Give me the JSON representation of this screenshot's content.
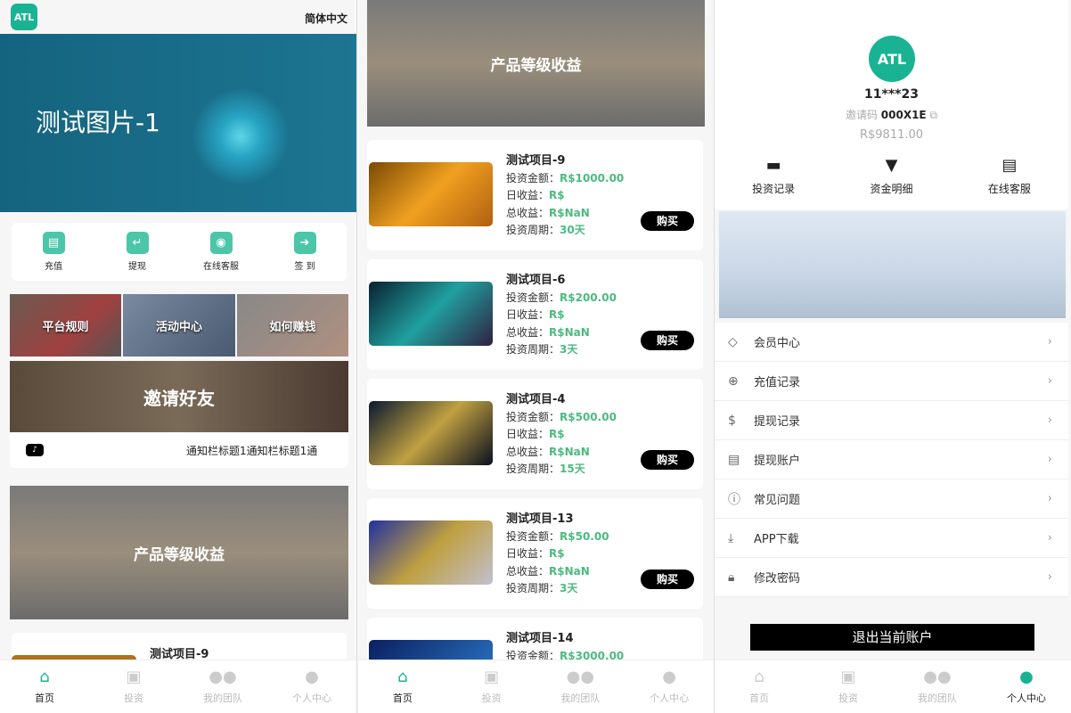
{
  "header": {
    "logo": "ATL",
    "language": "简体中文"
  },
  "home": {
    "banner_title": "测试图片-1",
    "quick": [
      {
        "label": "充值",
        "icon": "recharge-icon"
      },
      {
        "label": "提现",
        "icon": "withdraw-icon"
      },
      {
        "label": "在线客服",
        "icon": "support-icon"
      },
      {
        "label": "签 到",
        "icon": "checkin-icon"
      }
    ],
    "tiles": [
      "平台规则",
      "活动中心",
      "如何赚钱"
    ],
    "invite": "邀请好友",
    "notice": "通知栏标题1通知栏标题1通",
    "product_banner": "产品等级收益",
    "first_product": "测试项目-9"
  },
  "invest": {
    "banner": "产品等级收益",
    "labels": {
      "amount": "投资金额：",
      "daily": "日收益：",
      "total": "总收益：",
      "period": "投资周期：",
      "buy": "购买"
    },
    "products": [
      {
        "name": "测试项目-9",
        "amount": "R$1000.00",
        "daily": "R$",
        "total": "R$NaN",
        "period": "30天"
      },
      {
        "name": "测试项目-6",
        "amount": "R$200.00",
        "daily": "R$",
        "total": "R$NaN",
        "period": "3天"
      },
      {
        "name": "测试项目-4",
        "amount": "R$500.00",
        "daily": "R$",
        "total": "R$NaN",
        "period": "15天"
      },
      {
        "name": "测试项目-13",
        "amount": "R$50.00",
        "daily": "R$",
        "total": "R$NaN",
        "period": "3天"
      },
      {
        "name": "测试项目-14",
        "amount": "R$3000.00"
      }
    ]
  },
  "profile": {
    "avatar": "ATL",
    "username": "11***23",
    "invite_label": "邀请码",
    "invite_code": "000X1E",
    "balance": "R$9811.00",
    "actions": [
      {
        "label": "投资记录",
        "icon": "card-icon"
      },
      {
        "label": "资金明细",
        "icon": "atm-icon"
      },
      {
        "label": "在线客服",
        "icon": "document-icon"
      }
    ],
    "menu": [
      {
        "label": "会员中心",
        "icon": "diamond-icon"
      },
      {
        "label": "充值记录",
        "icon": "recharge-icon"
      },
      {
        "label": "提现记录",
        "icon": "dollar-icon"
      },
      {
        "label": "提现账户",
        "icon": "account-icon"
      },
      {
        "label": "常见问题",
        "icon": "info-icon"
      },
      {
        "label": "APP下载",
        "icon": "download-icon"
      },
      {
        "label": "修改密码",
        "icon": "lock-icon"
      }
    ],
    "logout": "退出当前账户"
  },
  "tabbar": {
    "items": [
      "首页",
      "投资",
      "我的团队",
      "个人中心"
    ]
  },
  "colors": {
    "accent": "#19b394",
    "value_green": "#4cba80"
  }
}
